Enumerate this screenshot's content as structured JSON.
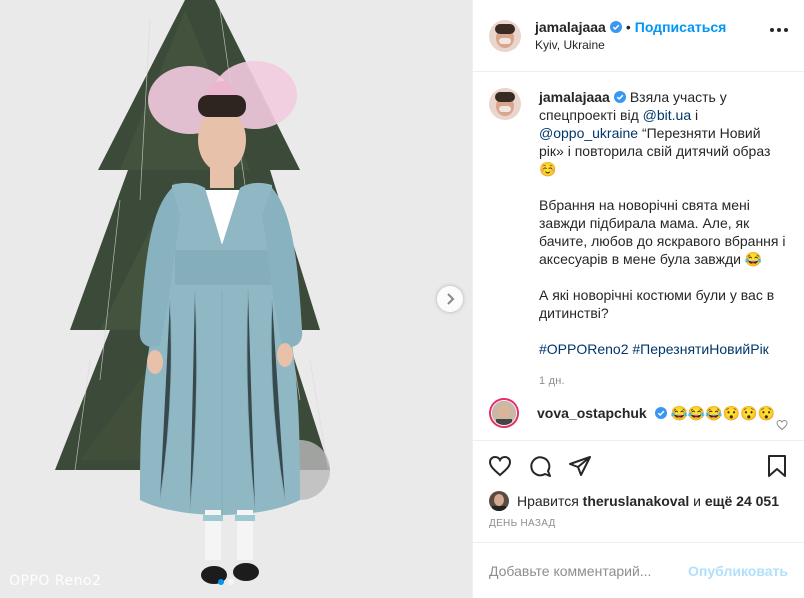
{
  "post": {
    "media": {
      "watermark": "OPPO Reno2",
      "dots_count": 2,
      "active_dot": 0
    },
    "header": {
      "username": "jamalajaaa",
      "separator": "•",
      "follow_label": "Подписаться",
      "location": "Kyiv, Ukraine"
    },
    "caption": {
      "username": "jamalajaaa",
      "p1_a": "Взяла участь у спецпроекті від ",
      "mention1": "@bit.ua",
      "p1_b": " і ",
      "mention2": "@oppo_ukraine",
      "p1_c": " “Перезняти Новий рік» і повторила свій дитячий образ ☺️",
      "p2": "Вбрання на новорічні свята мені завжди підбирала мама. Але, як бачите, любов до яскравого вбрання і аксесуарів в мене була завжди 😂",
      "p3": "А які новорічні костюми були у вас в дитинстві?",
      "hashtag1": "#OPPOReno2",
      "hashtag2": "#ПерезнятиНовийРік",
      "time": "1 дн."
    },
    "comment": {
      "username": "vova_ostapchuk",
      "text": "😂😂😂😯😯😯"
    },
    "likes": {
      "prefix": "Нравится ",
      "user": "theruslanakoval",
      "middle": " и ",
      "others": "ещё 24 051"
    },
    "date": "ДЕНЬ НАЗАД",
    "add_comment": {
      "placeholder": "Добавьте комментарий...",
      "publish_label": "Опубликовать"
    },
    "colors": {
      "accent": "#0095f6",
      "link": "#00376b",
      "muted": "#8e8e8e",
      "dress": "#8fb8c4"
    }
  }
}
